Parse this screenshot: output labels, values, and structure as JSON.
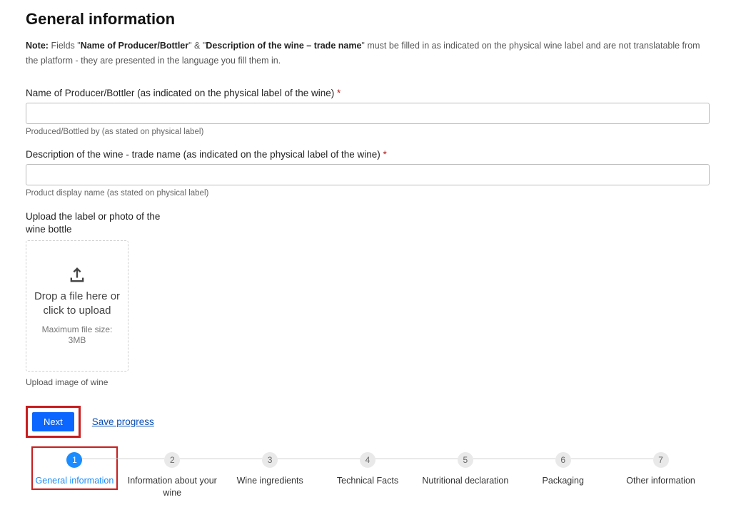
{
  "heading": "General information",
  "note": {
    "label": "Note:",
    "t1": "Fields \"",
    "b1": "Name of Producer/Bottler",
    "t2": "\" & \"",
    "b2": "Description of the wine – trade name",
    "t3": "\" must be filled in as indicated on the physical wine label and are not translatable from the platform - they are presented in the language you fill them in."
  },
  "fields": {
    "producer": {
      "label": "Name of Producer/Bottler (as indicated on the physical label of the wine)",
      "required": "*",
      "help": "Produced/Bottled by (as stated on physical label)"
    },
    "description": {
      "label": "Description of the wine - trade name (as indicated on the physical label of the wine)",
      "required": "*",
      "help": "Product display name (as stated on physical label)"
    },
    "upload": {
      "label": "Upload the label or photo of the wine bottle",
      "main": "Drop a file here or click to upload",
      "sub": "Maximum file size: 3MB",
      "help": "Upload image of wine"
    }
  },
  "actions": {
    "next": "Next",
    "save": "Save progress"
  },
  "stepper": {
    "steps": [
      {
        "n": "1",
        "label": "General information"
      },
      {
        "n": "2",
        "label": "Information about your wine"
      },
      {
        "n": "3",
        "label": "Wine ingredients"
      },
      {
        "n": "4",
        "label": "Technical Facts"
      },
      {
        "n": "5",
        "label": "Nutritional declaration"
      },
      {
        "n": "6",
        "label": "Packaging"
      },
      {
        "n": "7",
        "label": "Other information"
      }
    ],
    "active_index": 0
  }
}
